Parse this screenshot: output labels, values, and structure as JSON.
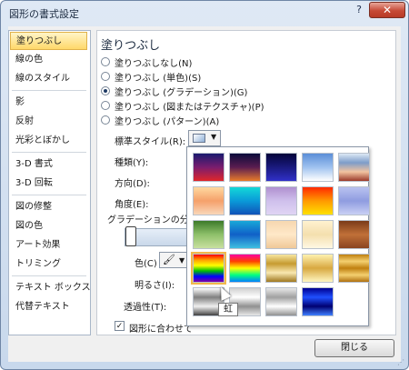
{
  "window": {
    "title": "図形の書式設定",
    "help_button": "?",
    "close_glyph": "✕"
  },
  "sidebar": {
    "items": [
      {
        "label": "塗りつぶし",
        "selected": true
      },
      {
        "label": "線の色"
      },
      {
        "label": "線のスタイル"
      },
      {
        "label": "影"
      },
      {
        "label": "反射"
      },
      {
        "label": "光彩とぼかし"
      },
      {
        "label": "3-D 書式"
      },
      {
        "label": "3-D 回転"
      },
      {
        "label": "図の修整"
      },
      {
        "label": "図の色"
      },
      {
        "label": "アート効果"
      },
      {
        "label": "トリミング"
      },
      {
        "label": "テキスト ボックス"
      },
      {
        "label": "代替テキスト"
      }
    ]
  },
  "fill": {
    "heading": "塗りつぶし",
    "options": [
      {
        "label": "塗りつぶしなし(N)",
        "selected": false
      },
      {
        "label": "塗りつぶし (単色)(S)",
        "selected": false
      },
      {
        "label": "塗りつぶし (グラデーション)(G)",
        "selected": true
      },
      {
        "label": "塗りつぶし (図またはテクスチャ)(P)",
        "selected": false
      },
      {
        "label": "塗りつぶし (パターン)(A)",
        "selected": false
      }
    ],
    "preset_label": "標準スタイル(R):",
    "type_label": "種類(Y):",
    "direction_label": "方向(D):",
    "angle_label": "角度(E):",
    "stops_label": "グラデーションの分岐",
    "color_label": "色(C)",
    "brightness_label": "明るさ(I):",
    "transparency_label": "透過性(T):",
    "rotate_checkbox_label": "図形に合わせて",
    "rotate_checked": true
  },
  "gallery": {
    "tooltip": "虹",
    "highlighted_index": 15,
    "presets": [
      {
        "name": "late-sunset",
        "stops": [
          "#1a1a6e",
          "#7a1d6e",
          "#e0262a"
        ]
      },
      {
        "name": "early-sunset",
        "stops": [
          "#0b0b3a",
          "#5a1d50",
          "#e87b2a"
        ]
      },
      {
        "name": "nightfall",
        "stops": [
          "#05053a",
          "#1a1a7e",
          "#3030c8"
        ]
      },
      {
        "name": "daybreak",
        "stops": [
          "#5a8ed8",
          "#9fc2ef",
          "#ffffff"
        ]
      },
      {
        "name": "horizon",
        "stops": [
          "#dce8f5",
          "#7d9cc9",
          "#f2c3a0",
          "#9b3a2a"
        ]
      },
      {
        "name": "desert",
        "stops": [
          "#ffd9a0",
          "#f5a06a",
          "#f9d7b9"
        ]
      },
      {
        "name": "ocean",
        "stops": [
          "#13d8d8",
          "#0a9ad8",
          "#1052b8"
        ]
      },
      {
        "name": "calm-water",
        "stops": [
          "#b090d0",
          "#cfc0ec",
          "#e0d4f4"
        ]
      },
      {
        "name": "fire",
        "stops": [
          "#ff2a00",
          "#ff9a00",
          "#ffe000"
        ]
      },
      {
        "name": "fog",
        "stops": [
          "#b9c2f0",
          "#8f9ce0",
          "#c9d0f4"
        ]
      },
      {
        "name": "moss",
        "stops": [
          "#3c7a2a",
          "#8ec06a",
          "#c8e0a0"
        ]
      },
      {
        "name": "peacock",
        "stops": [
          "#18a8d8",
          "#1060c8",
          "#40c0e0"
        ]
      },
      {
        "name": "wheat",
        "stops": [
          "#f6d7b0",
          "#ffe8c8",
          "#f0c898"
        ]
      },
      {
        "name": "parchment",
        "stops": [
          "#fff2d0",
          "#f4dfae",
          "#fff8e4"
        ]
      },
      {
        "name": "mahogany",
        "stops": [
          "#7a3a18",
          "#c07038",
          "#8a4420"
        ]
      },
      {
        "name": "rainbow",
        "stops": [
          "#ff0000",
          "#ffa000",
          "#ffff00",
          "#00c000",
          "#0000ff",
          "#8000a0"
        ]
      },
      {
        "name": "rainbow-2",
        "stops": [
          "#ff00a0",
          "#ff4000",
          "#ffff00",
          "#00ff80",
          "#0080ff"
        ]
      },
      {
        "name": "gold",
        "stops": [
          "#f7e6a0",
          "#c69b30",
          "#f8e8b0",
          "#a07820"
        ]
      },
      {
        "name": "gold-2",
        "stops": [
          "#fff2b0",
          "#d8a840",
          "#fff6c0"
        ]
      },
      {
        "name": "brass",
        "stops": [
          "#c08010",
          "#f4d070",
          "#c08010",
          "#f4d070",
          "#b07010"
        ]
      },
      {
        "name": "chrome",
        "stops": [
          "#ffffff",
          "#808080",
          "#f0f0f0",
          "#404040"
        ]
      },
      {
        "name": "chrome-2",
        "stops": [
          "#d0d0d0",
          "#ffffff",
          "#909090",
          "#e8e8e8"
        ]
      },
      {
        "name": "silver",
        "stops": [
          "#e8e8e8",
          "#a0a0a0",
          "#ffffff",
          "#909090"
        ]
      },
      {
        "name": "sapphire",
        "stops": [
          "#000090",
          "#2050ff",
          "#000070",
          "#4080ff"
        ]
      }
    ]
  },
  "footer": {
    "close_button": "閉じる"
  }
}
